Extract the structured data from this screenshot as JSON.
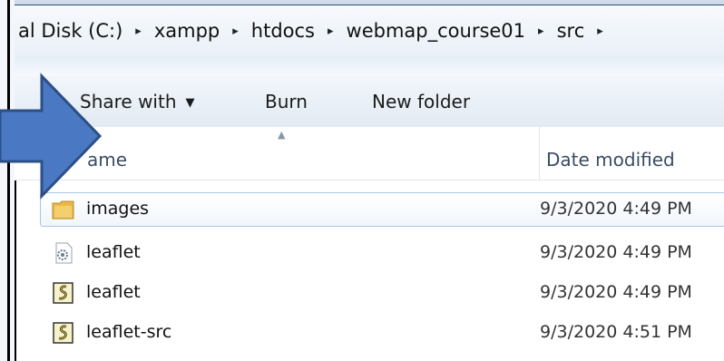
{
  "address": {
    "crumbs": [
      "al Disk (C:)",
      "xampp",
      "htdocs",
      "webmap_course01",
      "src"
    ],
    "separator": "▸"
  },
  "toolbar": {
    "share_label": "Share with",
    "burn_label": "Burn",
    "new_folder_label": "New folder"
  },
  "columns": {
    "name": "ame",
    "date": "Date modified"
  },
  "files": [
    {
      "name": "images",
      "date": "9/3/2020 4:49 PM",
      "icon": "folder-icon"
    },
    {
      "name": "leaflet",
      "date": "9/3/2020 4:49 PM",
      "icon": "css-file-icon"
    },
    {
      "name": "leaflet",
      "date": "9/3/2020 4:49 PM",
      "icon": "js-script-icon"
    },
    {
      "name": "leaflet-src",
      "date": "9/3/2020 4:51 PM",
      "icon": "js-script-icon"
    }
  ],
  "colors": {
    "arrow_fill": "#4a78c2",
    "arrow_stroke": "#2c4f86",
    "folder": "#e8b948"
  }
}
